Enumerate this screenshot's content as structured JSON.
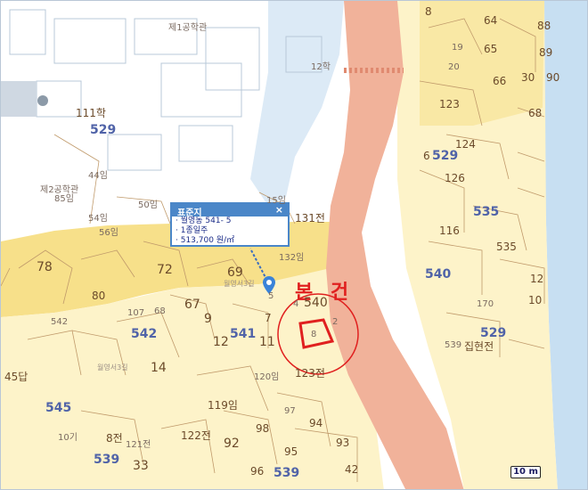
{
  "popup": {
    "title": "표준지",
    "close": "×",
    "address": "· 월영동 541- 5",
    "zoning": "· 1종일주",
    "price": "· 513,700 원/㎡"
  },
  "subject_label": "본 건",
  "scale_label": "10 m",
  "labels": {
    "gonghakgwan1": "제1공학관",
    "gonghakgwan2": "제2공학관",
    "hak111": "111학",
    "block529a": "529",
    "block529b": "529",
    "n85im": "85임",
    "n44im": "44임",
    "n50im": "50임",
    "n54im": "54임",
    "n56im": "56임",
    "n12hak": "12학",
    "n15im": "15임",
    "n131jeon": "131전",
    "n132im": "132임",
    "n78": "78",
    "n72": "72",
    "n80": "80",
    "n69": "69",
    "n67": "67",
    "n68": "68",
    "n107": "107",
    "n542a": "542",
    "n542b": "542",
    "n541": "541",
    "n540": "540",
    "n540b": "540",
    "n5": "5",
    "n9": "9",
    "n7": "7",
    "n12": "12",
    "n11": "11",
    "n4": "4",
    "n2": "2",
    "n8box": "8",
    "n14": "14",
    "n123jeon": "123전",
    "n120im": "120임",
    "n119im": "119임",
    "n97": "97",
    "n98": "98",
    "n94": "94",
    "n93": "93",
    "n92": "92",
    "n95": "95",
    "n96": "96",
    "n42": "42",
    "n539a": "539",
    "n539b": "539",
    "n539c": "539",
    "n122jeon": "122전",
    "n121jeon": "121전",
    "n33": "33",
    "n8jeon": "8전",
    "n545": "545",
    "n45dap": "45답",
    "n10gi": "10기",
    "n8": "8",
    "n64": "64",
    "n88": "88",
    "n65": "65",
    "n89": "89",
    "n19": "19",
    "n20": "20",
    "n66": "66",
    "n30": "30",
    "n90": "90",
    "n123": "123",
    "n68b": "68",
    "n124": "124",
    "n529": "529",
    "n6": "6",
    "n126": "126",
    "n535a": "535",
    "n535b": "535",
    "n116": "116",
    "n12b": "12",
    "n10": "10",
    "n170": "170",
    "n539d": "539",
    "n529b": "529",
    "jiphyeon": "집현전",
    "road1": "월영서3길",
    "road2": "월영서3길"
  }
}
